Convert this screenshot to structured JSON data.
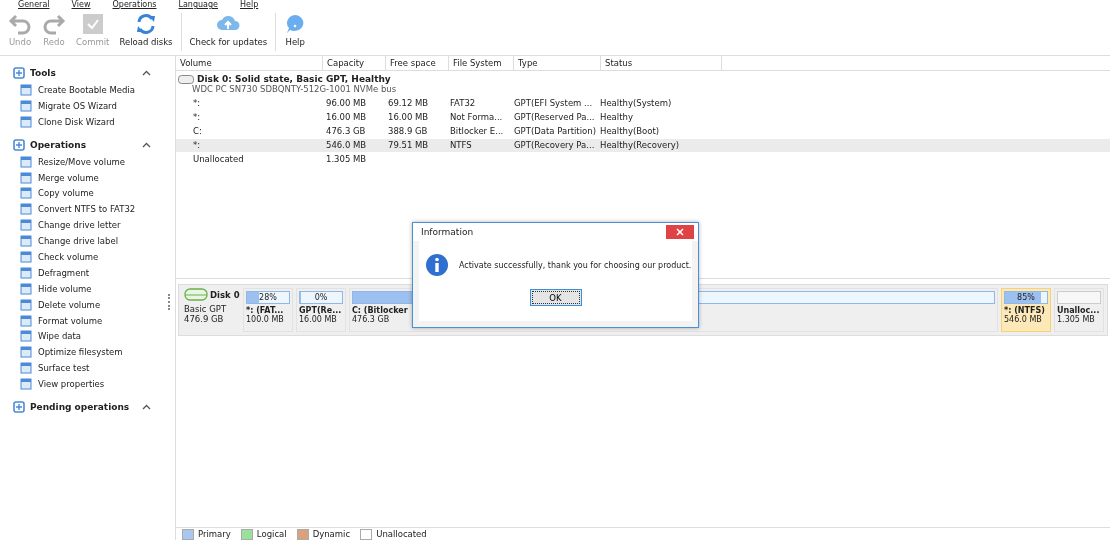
{
  "menu": [
    "General",
    "View",
    "Operations",
    "Language",
    "Help"
  ],
  "toolbar": [
    {
      "label": "Undo",
      "kind": "undo",
      "disabled": true
    },
    {
      "label": "Redo",
      "kind": "redo",
      "disabled": true
    },
    {
      "label": "Commit",
      "kind": "commit",
      "disabled": true
    },
    {
      "label": "Reload disks",
      "kind": "reload",
      "disabled": false
    },
    {
      "label": "Check for updates",
      "kind": "update",
      "disabled": false
    },
    {
      "label": "Help",
      "kind": "help",
      "disabled": false
    }
  ],
  "sidebar": [
    {
      "title": "Tools",
      "expanded": true,
      "items": [
        "Create Bootable Media",
        "Migrate OS Wizard",
        "Clone Disk Wizard"
      ]
    },
    {
      "title": "Operations",
      "expanded": true,
      "items": [
        "Resize/Move volume",
        "Merge volume",
        "Copy volume",
        "Convert NTFS to FAT32",
        "Change drive letter",
        "Change drive label",
        "Check volume",
        "Defragment",
        "Hide volume",
        "Delete volume",
        "Format volume",
        "Wipe data",
        "Optimize filesystem",
        "Surface test",
        "View properties"
      ]
    },
    {
      "title": "Pending operations",
      "expanded": true
    }
  ],
  "table": {
    "columns": [
      "Volume",
      "Capacity",
      "Free space",
      "File System",
      "Type",
      "Status"
    ],
    "disk": {
      "title": "Disk 0: Solid state, Basic GPT, Healthy",
      "model": "WDC PC SN730 SDBQNTY-512G-1001 NVMe bus"
    },
    "rows": [
      {
        "cells": [
          "*:",
          "96.00 MB",
          "69.12 MB",
          "FAT32",
          "GPT(EFI System ...",
          "Healthy(System)"
        ],
        "selected": false
      },
      {
        "cells": [
          "*:",
          "16.00 MB",
          "16.00 MB",
          "Not Forma...",
          "GPT(Reserved Pa...",
          "Healthy"
        ],
        "selected": false
      },
      {
        "cells": [
          "C:",
          "476.3 GB",
          "388.9 GB",
          "Bitlocker E...",
          "GPT(Data Partition)",
          "Healthy(Boot)"
        ],
        "selected": false
      },
      {
        "cells": [
          "*:",
          "546.0 MB",
          "79.51 MB",
          "NTFS",
          "GPT(Recovery Pa...",
          "Healthy(Recovery)"
        ],
        "selected": true
      },
      {
        "cells": [
          "Unallocated",
          "1.305 MB",
          "",
          "",
          "",
          ""
        ],
        "selected": false
      }
    ]
  },
  "disk_map": {
    "name": "Disk 0",
    "type": "Basic GPT",
    "size": "476.9 GB",
    "partitions": [
      {
        "percent": "28%",
        "level": 0.28,
        "label": "*: (FAT...",
        "size": "100.0 MB",
        "kind": "primary",
        "selected": false
      },
      {
        "percent": "0%",
        "level": 0.0,
        "label": "GPT(Re...",
        "size": "16.00 MB",
        "kind": "primary",
        "selected": false
      },
      {
        "level": 0.18,
        "label": "C: (Bitlocker",
        "size": "476.3 GB",
        "kind": "primary",
        "selected": false
      },
      {
        "percent": "85%",
        "level": 0.85,
        "label": "*: (NTFS)",
        "size": "546.0 MB",
        "kind": "primary",
        "selected": true
      },
      {
        "label": "Unalloc...",
        "size": "1.305 MB",
        "kind": "unallocated",
        "selected": false
      }
    ]
  },
  "dialog": {
    "title": "Information",
    "message": "Activate successfully, thank you for choosing our product.",
    "button": "OK"
  },
  "legend": [
    {
      "label": "Primary",
      "color": "#a9c8f0"
    },
    {
      "label": "Logical",
      "color": "#9be09b"
    },
    {
      "label": "Dynamic",
      "color": "#d9a27a"
    },
    {
      "label": "Unallocated",
      "color": "#ffffff"
    }
  ]
}
